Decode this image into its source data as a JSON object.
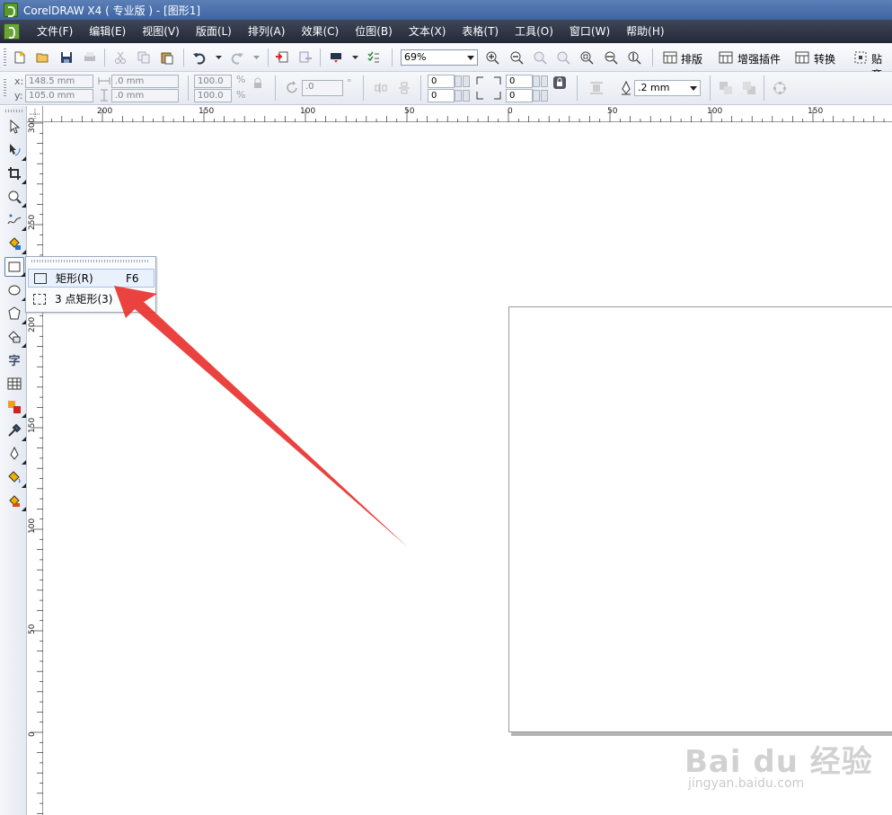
{
  "window": {
    "title": "CorelDRAW X4 ( 专业版 ) - [图形1]"
  },
  "menu": [
    "文件(F)",
    "编辑(E)",
    "视图(V)",
    "版面(L)",
    "排列(A)",
    "效果(C)",
    "位图(B)",
    "文本(X)",
    "表格(T)",
    "工具(O)",
    "窗口(W)",
    "帮助(H)"
  ],
  "toolbar": {
    "zoom": "69%",
    "layout_label": "排版",
    "plugin_label": "增强插件",
    "convert_label": "转换",
    "snap_label": "贴齐"
  },
  "property_bar": {
    "x_label": "x:",
    "y_label": "y:",
    "x_value": "148.5 mm",
    "y_value": "105.0 mm",
    "width_value": ".0 mm",
    "height_value": ".0 mm",
    "scale_x": "100.0",
    "scale_y": "100.0",
    "percent": "%",
    "rotation": ".0",
    "degree": "°",
    "corner_tl": "0",
    "corner_bl": "0",
    "corner_tr": "0",
    "corner_br": "0",
    "outline_width": ".2 mm"
  },
  "ruler_top": [
    "200",
    "150",
    "100",
    "50",
    "0",
    "50",
    "100",
    "150"
  ],
  "ruler_left": [
    "300",
    "250",
    "200",
    "150",
    "100",
    "50",
    "0"
  ],
  "flyout": {
    "items": [
      {
        "label": "矩形(R)",
        "shortcut": "F6"
      },
      {
        "label": "3 点矩形(3)",
        "shortcut": ""
      }
    ]
  },
  "watermark": {
    "brand": "Bai du 经验",
    "url": "jingyan.baidu.com"
  }
}
